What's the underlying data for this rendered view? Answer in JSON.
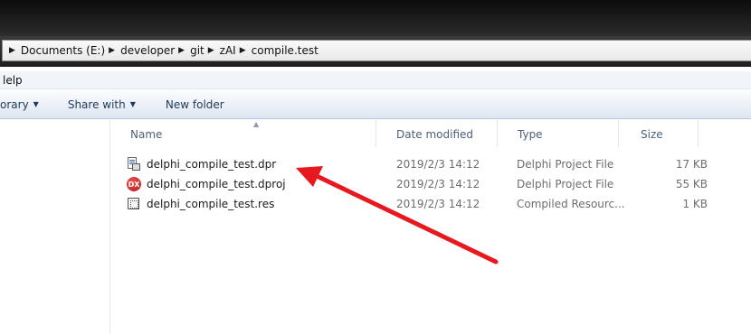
{
  "breadcrumb": [
    "Documents (E:)",
    "developer",
    "git",
    "zAI",
    "compile.test"
  ],
  "menubar": {
    "help_label": "lelp"
  },
  "toolbar": {
    "library_label": "orary",
    "share_label": "Share with",
    "new_folder_label": "New folder"
  },
  "columns": {
    "name": "Name",
    "date": "Date modified",
    "type": "Type",
    "size": "Size"
  },
  "files": [
    {
      "name": "delphi_compile_test.dpr",
      "date": "2019/2/3 14:12",
      "type": "Delphi Project File",
      "size": "17 KB",
      "icon": "delphi-project-icon"
    },
    {
      "name": "delphi_compile_test.dproj",
      "date": "2019/2/3 14:12",
      "type": "Delphi Project File",
      "size": "55 KB",
      "icon": "delphi-dproj-icon"
    },
    {
      "name": "delphi_compile_test.res",
      "date": "2019/2/3 14:12",
      "type": "Compiled Resourc...",
      "size": "1 KB",
      "icon": "resource-file-icon"
    }
  ],
  "annotation": {
    "arrow_color": "#e8191e"
  },
  "icons": {
    "dproj_badge": "DX"
  }
}
